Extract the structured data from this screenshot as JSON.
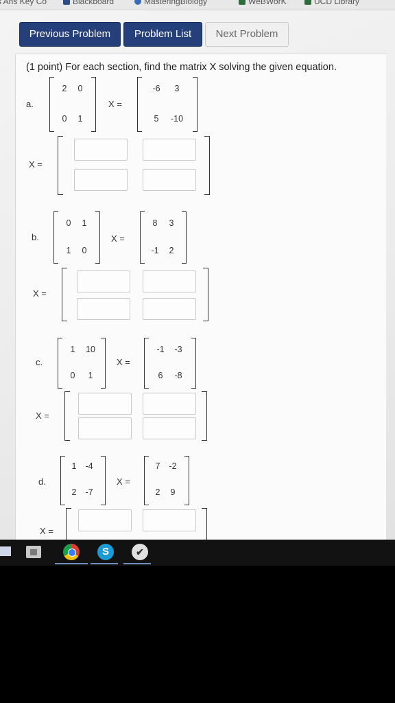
{
  "bookmarks": [
    {
      "label": "s Ans Key Co"
    },
    {
      "label": "Blackboard"
    },
    {
      "label": "MasteringBiology"
    },
    {
      "label": "WeBWorK"
    },
    {
      "label": "UCD Library"
    }
  ],
  "nav": {
    "previous": "Previous Problem",
    "list": "Problem List",
    "next": "Next Problem"
  },
  "problem": {
    "statement": "(1 point) For each section, find the matrix X solving the given equation.",
    "x_equals": "X =",
    "sections": [
      {
        "label": "a.",
        "A": [
          [
            "2",
            "0"
          ],
          [
            "0",
            "1"
          ]
        ],
        "B": [
          [
            "-6",
            "3"
          ],
          [
            "5",
            "-10"
          ]
        ]
      },
      {
        "label": "b.",
        "A": [
          [
            "0",
            "1"
          ],
          [
            "1",
            "0"
          ]
        ],
        "B": [
          [
            "8",
            "3"
          ],
          [
            "-1",
            "2"
          ]
        ]
      },
      {
        "label": "c.",
        "A": [
          [
            "1",
            "10"
          ],
          [
            "0",
            "1"
          ]
        ],
        "B": [
          [
            "-1",
            "-3"
          ],
          [
            "6",
            "-8"
          ]
        ]
      },
      {
        "label": "d.",
        "A": [
          [
            "1",
            "-4"
          ],
          [
            "2",
            "-7"
          ]
        ],
        "B": [
          [
            "7",
            "-2"
          ],
          [
            "2",
            "9"
          ]
        ]
      }
    ]
  },
  "taskbar": {
    "icons": [
      "store-icon",
      "chrome-icon",
      "skype-icon",
      "checkmark-app-icon"
    ],
    "skype_glyph": "S",
    "check_glyph": "✔"
  }
}
